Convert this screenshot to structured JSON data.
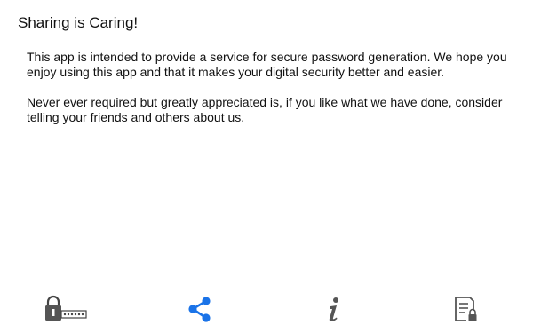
{
  "page": {
    "title": "Sharing is Caring!"
  },
  "content": {
    "paragraph_1": "This app is intended to provide a service for secure password generation. We hope you enjoy using this app and that it makes your digital security better and easier.",
    "paragraph_2": "Never ever required but greatly appreciated is, if you like what we have done, consider telling your friends and others about us."
  },
  "bottom_nav": {
    "items": [
      {
        "id": "generate",
        "icon": "padlock-password-icon",
        "active": false
      },
      {
        "id": "share",
        "icon": "share-icon",
        "active": true
      },
      {
        "id": "info",
        "icon": "info-icon",
        "active": false
      },
      {
        "id": "vault",
        "icon": "document-lock-icon",
        "active": false
      }
    ]
  },
  "colors": {
    "active": "#1a73e8",
    "inactive": "#555555",
    "background": "#ffffff",
    "text": "#111111"
  }
}
